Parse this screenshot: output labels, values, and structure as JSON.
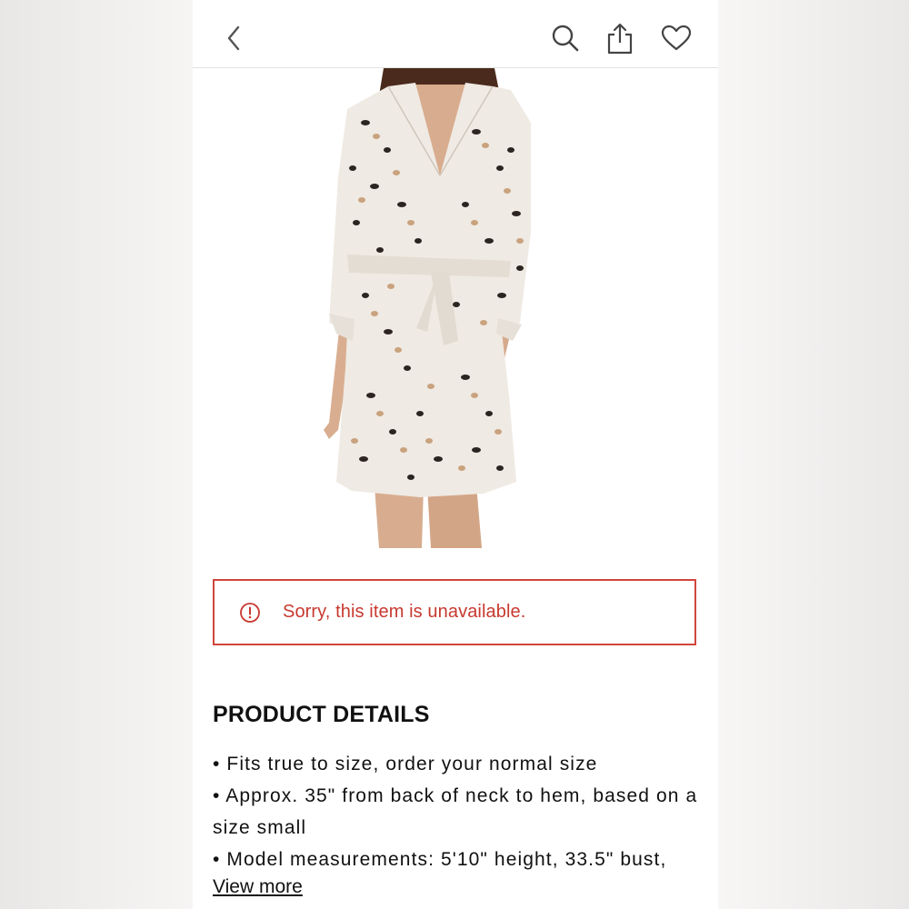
{
  "header": {
    "back_icon": "chevron-left-icon",
    "search_icon": "search-icon",
    "share_icon": "share-icon",
    "favorite_icon": "heart-icon"
  },
  "alert": {
    "icon": "alert-circle-icon",
    "message": "Sorry, this item is unavailable.",
    "color": "#c8392f"
  },
  "details": {
    "title": "PRODUCT DETAILS",
    "bullets": [
      "• Fits true to size, order your normal size",
      "• Approx. 35\" from back of neck to hem, based on a size small",
      "• Model measurements: 5'10\" height, 33.5\" bust,"
    ],
    "view_more": "View more"
  }
}
